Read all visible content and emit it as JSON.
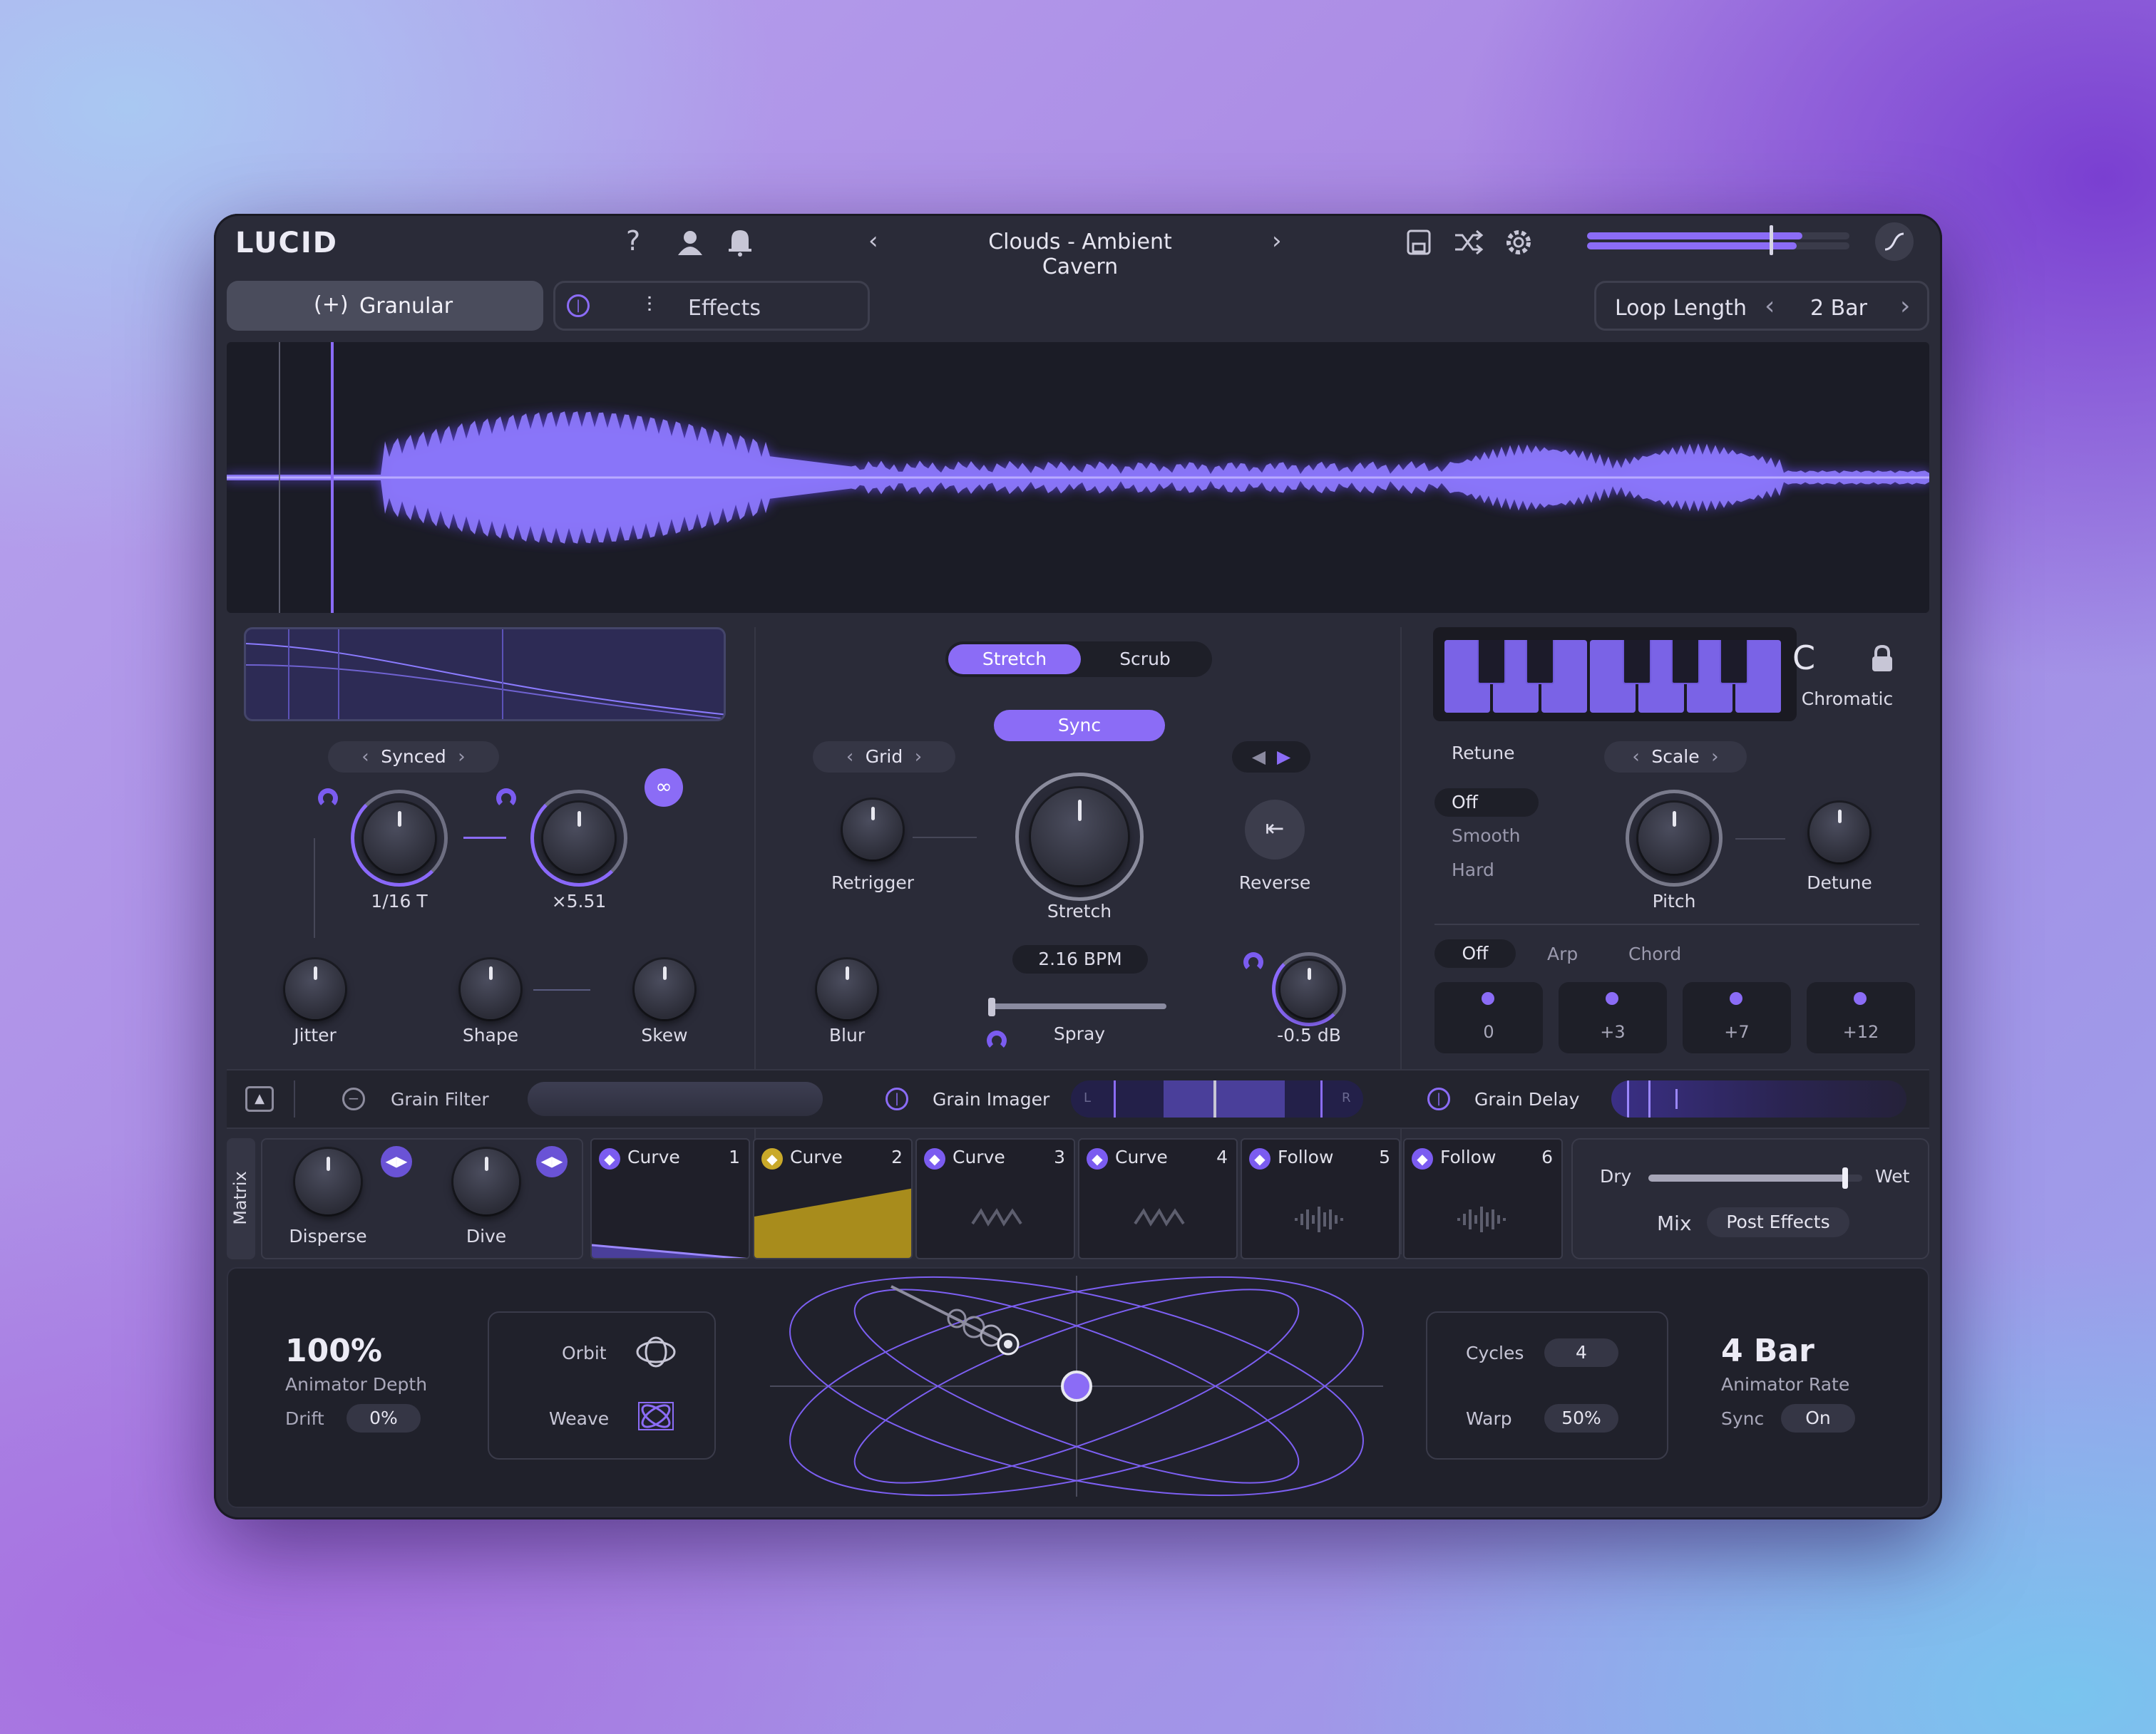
{
  "header": {
    "logo": "LUCID",
    "preset_name": "Clouds - Ambient Cavern",
    "output_level": 0.82
  },
  "tabs": {
    "granular": "Granular",
    "effects": "Effects"
  },
  "loop": {
    "label": "Loop Length",
    "value": "2 Bar"
  },
  "grain": {
    "mode": "Synced",
    "rate": "1/16 T",
    "multiplier": "×5.51",
    "jitter": "Jitter",
    "shape": "Shape",
    "skew": "Skew"
  },
  "playback": {
    "stretch_tab": "Stretch",
    "scrub_tab": "Scrub",
    "sync": "Sync",
    "grid": "Grid",
    "retrigger": "Retrigger",
    "stretch": "Stretch",
    "reverse": "Reverse",
    "bpm": "2.16 BPM",
    "blur": "Blur",
    "spray": "Spray",
    "gain": "-0.5 dB"
  },
  "pitch": {
    "key": "C",
    "scale_name": "Chromatic",
    "retune_label": "Retune",
    "scale_selector": "Scale",
    "retune_options": [
      "Off",
      "Smooth",
      "Hard"
    ],
    "pitch": "Pitch",
    "detune": "Detune",
    "modes": [
      "Off",
      "Arp",
      "Chord"
    ],
    "steps": [
      "0",
      "+3",
      "+7",
      "+12"
    ]
  },
  "fx_bar": {
    "grain_filter": "Grain Filter",
    "grain_imager": "Grain Imager",
    "grain_delay": "Grain Delay",
    "imager_l": "L",
    "imager_r": "R"
  },
  "matrix": {
    "label": "Matrix",
    "disperse": "Disperse",
    "dive": "Dive",
    "slots": [
      {
        "name": "Curve",
        "num": "1"
      },
      {
        "name": "Curve",
        "num": "2"
      },
      {
        "name": "Curve",
        "num": "3"
      },
      {
        "name": "Curve",
        "num": "4"
      },
      {
        "name": "Follow",
        "num": "5"
      },
      {
        "name": "Follow",
        "num": "6"
      }
    ]
  },
  "mix": {
    "dry": "Dry",
    "wet": "Wet",
    "mix_label": "Mix",
    "mode": "Post Effects",
    "value": 0.92
  },
  "animator": {
    "depth_value": "100%",
    "depth_label": "Animator Depth",
    "drift_label": "Drift",
    "drift_value": "0%",
    "orbit": "Orbit",
    "weave": "Weave",
    "cycles_label": "Cycles",
    "cycles_value": "4",
    "warp_label": "Warp",
    "warp_value": "50%",
    "rate_value": "4 Bar",
    "rate_label": "Animator Rate",
    "sync_label": "Sync",
    "sync_value": "On"
  },
  "colors": {
    "accent": "#8b6cf6",
    "highlight": "#c9a92a",
    "panel": "#2a2b38"
  },
  "icons": [
    "help-icon",
    "user-icon",
    "bell-icon",
    "save-icon",
    "shuffle-icon",
    "gear-icon",
    "curve-icon",
    "lock-icon"
  ]
}
